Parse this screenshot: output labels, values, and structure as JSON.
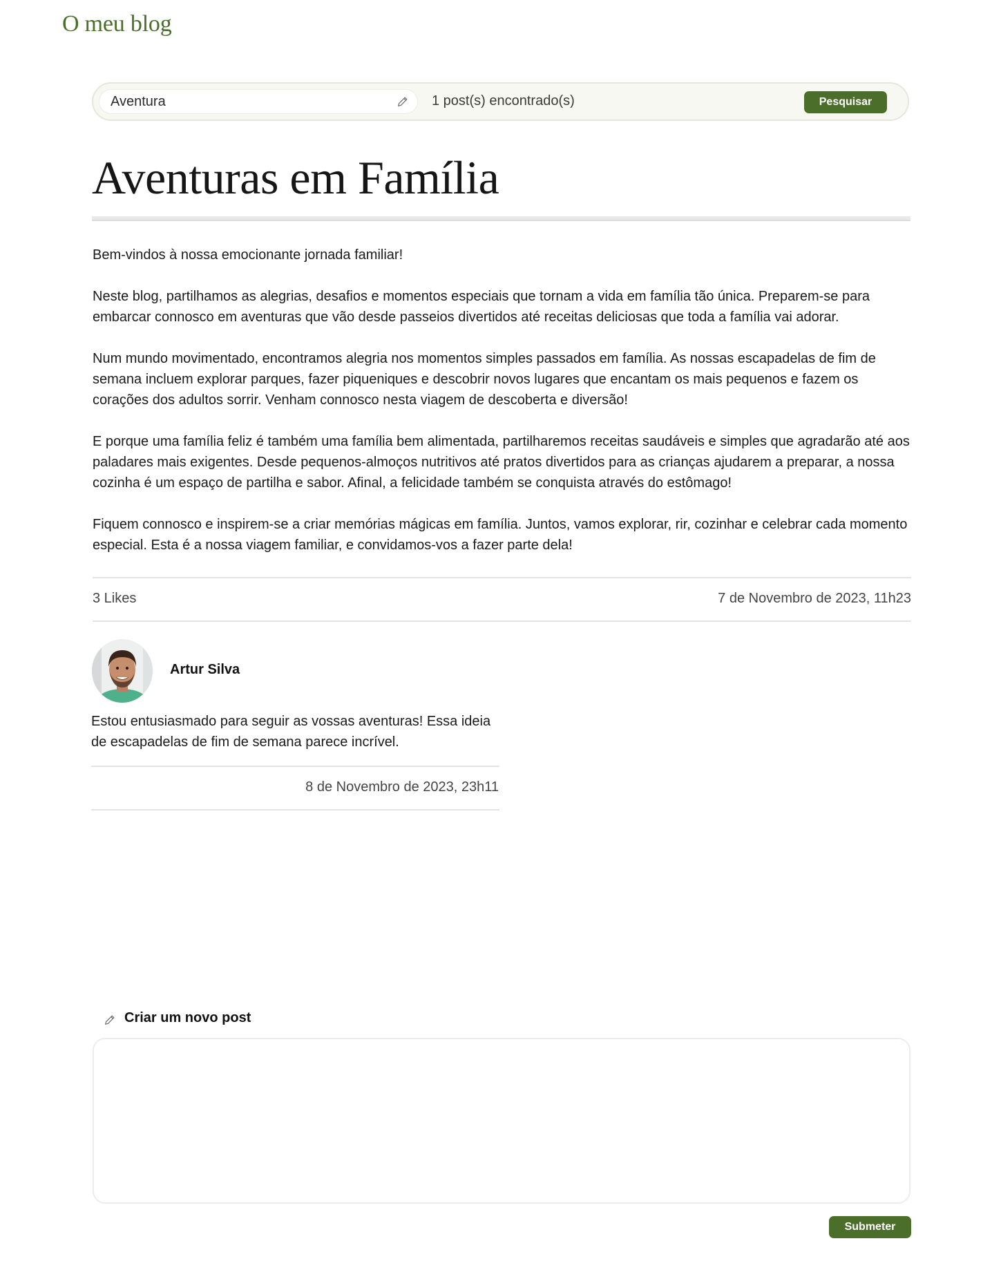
{
  "site": {
    "title": "O meu blog"
  },
  "search": {
    "value": "Aventura",
    "results_text": "1 post(s) encontrado(s)",
    "button_label": "Pesquisar"
  },
  "post": {
    "title": "Aventuras em Família",
    "paragraphs": [
      "Bem-vindos à nossa emocionante jornada familiar!",
      "Neste blog, partilhamos as alegrias, desafios e momentos especiais que tornam a vida em família tão única. Preparem-se para embarcar connosco em aventuras que vão desde passeios divertidos até receitas deliciosas que toda a família vai adorar.",
      "Num mundo movimentado, encontramos alegria nos momentos simples passados em família. As nossas escapadelas de fim de semana incluem explorar parques, fazer piqueniques e descobrir novos lugares que encantam os mais pequenos e fazem os corações dos adultos sorrir. Venham connosco nesta viagem de descoberta e diversão!",
      "E porque uma família feliz é também uma família bem alimentada, partilharemos receitas saudáveis e simples que agradarão até aos paladares mais exigentes. Desde pequenos-almoços nutritivos até pratos divertidos para as crianças ajudarem a preparar, a nossa cozinha é um espaço de partilha e sabor. Afinal, a felicidade também se conquista através do estômago!",
      "Fiquem connosco e inspirem-se a criar memórias mágicas em família. Juntos, vamos explorar, rir, cozinhar e celebrar cada momento especial. Esta é a nossa viagem familiar, e convidamos-vos a fazer parte dela!"
    ],
    "likes": "3 Likes",
    "date": "7 de Novembro de 2023, 11h23"
  },
  "comment": {
    "author": "Artur Silva",
    "text": "Estou entusiasmado para seguir as vossas aventuras! Essa ideia de escapadelas de fim de semana parece incrível.",
    "date": "8 de Novembro de 2023, 23h11"
  },
  "new_post": {
    "header": "Criar um novo post",
    "submit_label": "Submeter"
  },
  "colors": {
    "accent": "#4b6e2a"
  },
  "icons": {
    "search_field": "pencil-icon",
    "new_post": "pencil-icon"
  }
}
